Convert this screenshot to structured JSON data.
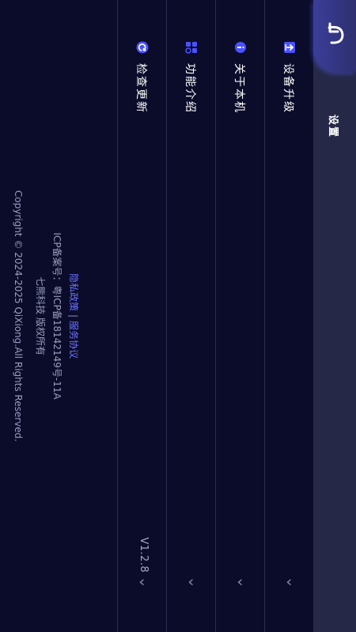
{
  "header": {
    "title": "设置",
    "back_icon": "back-arrow-icon",
    "accent": "#3b3e9a"
  },
  "menu": {
    "items": [
      {
        "id": "device-upgrade",
        "label": "设备升级",
        "icon": "upgrade-icon"
      },
      {
        "id": "about",
        "label": "关于本机",
        "icon": "info-icon"
      },
      {
        "id": "features",
        "label": "功能介绍",
        "icon": "grid-icon"
      },
      {
        "id": "check-update",
        "label": "检查更新",
        "icon": "refresh-icon",
        "value": "V1.2.8"
      }
    ]
  },
  "footer": {
    "privacy_link": "隐私政策",
    "separator": "|",
    "service_link": "服务协议",
    "icp": "ICP备案号：粤ICP备18142149号-11A",
    "company": "七熊科技 版权所有",
    "copyright": "Copyright © 2024-2025 QiXiong.All Rights Reserved."
  },
  "colors": {
    "background": "#0b0c2a",
    "header_bg": "#262847",
    "icon_accent": "#4a52ff",
    "link": "#6b73ff"
  }
}
